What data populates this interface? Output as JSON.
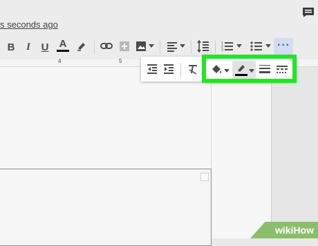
{
  "header": {
    "saved_status": "s seconds ago"
  },
  "toolbar": {
    "bold": "B",
    "italic": "I",
    "underline": "U",
    "text_color": "A",
    "more_button": "···"
  },
  "ruler": {
    "mark_4": "4",
    "mark_5": "5"
  },
  "colors": {
    "highlight_green": "#22e622",
    "more_button_bg": "#d3dcf2",
    "watermark_green": "#8bbe6a"
  },
  "icons": [
    "comment-icon",
    "bold-icon",
    "italic-icon",
    "underline-icon",
    "text-color-icon",
    "highlight-icon",
    "link-icon",
    "insert-comment-icon",
    "image-icon",
    "align-icon",
    "line-spacing-icon",
    "numbered-list-icon",
    "bulleted-list-icon",
    "more-icon",
    "decrease-indent-icon",
    "increase-indent-icon",
    "clear-formatting-icon",
    "fill-color-icon",
    "border-color-icon",
    "border-width-icon",
    "border-dash-icon"
  ],
  "watermark": {
    "text": "wikiHow"
  }
}
